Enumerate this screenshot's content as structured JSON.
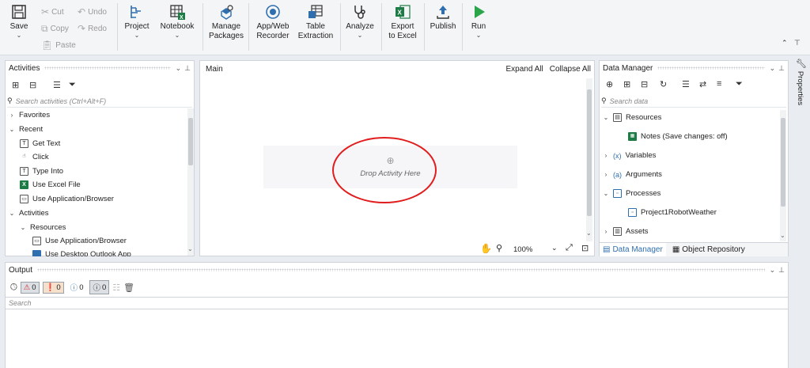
{
  "ribbon": {
    "save": "Save",
    "cut": "Cut",
    "copy": "Copy",
    "paste": "Paste",
    "undo": "Undo",
    "redo": "Redo",
    "project": "Project",
    "notebook": "Notebook",
    "manage_packages_1": "Manage",
    "manage_packages_2": "Packages",
    "recorder_1": "App/Web",
    "recorder_2": "Recorder",
    "table_1": "Table",
    "table_2": "Extraction",
    "analyze": "Analyze",
    "export_1": "Export",
    "export_2": "to Excel",
    "publish": "Publish",
    "run": "Run"
  },
  "activities": {
    "title": "Activities",
    "search_placeholder": "Search activities (Ctrl+Alt+F)",
    "items": [
      {
        "label": "Favorites"
      },
      {
        "label": "Recent"
      },
      {
        "label": "Get Text"
      },
      {
        "label": "Click"
      },
      {
        "label": "Type Into"
      },
      {
        "label": "Use Excel File"
      },
      {
        "label": "Use Application/Browser"
      },
      {
        "label": "Activities"
      },
      {
        "label": "Resources"
      },
      {
        "label": "Use Application/Browser"
      },
      {
        "label": "Use Desktop Outlook App"
      }
    ]
  },
  "designer": {
    "title": "Main",
    "expand_all": "Expand All",
    "collapse_all": "Collapse All",
    "drop_text": "Drop Activity Here",
    "zoom": "100%"
  },
  "data_manager": {
    "title": "Data Manager",
    "search_placeholder": "Search data",
    "items": [
      {
        "label": "Resources"
      },
      {
        "label": "Notes (Save changes: off)"
      },
      {
        "label": "Variables"
      },
      {
        "label": "Arguments"
      },
      {
        "label": "Processes"
      },
      {
        "label": "Project1RobotWeather"
      },
      {
        "label": "Assets"
      }
    ],
    "tab_data_manager": "Data Manager",
    "tab_object_repository": "Object Repository"
  },
  "properties_tab": "Properties",
  "output": {
    "title": "Output",
    "errors": "0",
    "warnings": "0",
    "info": "0",
    "trace": "0",
    "search_placeholder": "Search"
  },
  "colors": {
    "accent": "#2f6fb0",
    "ellipse": "#e11d1d",
    "run_green": "#2aa54a",
    "excel_green": "#1d7b45"
  }
}
